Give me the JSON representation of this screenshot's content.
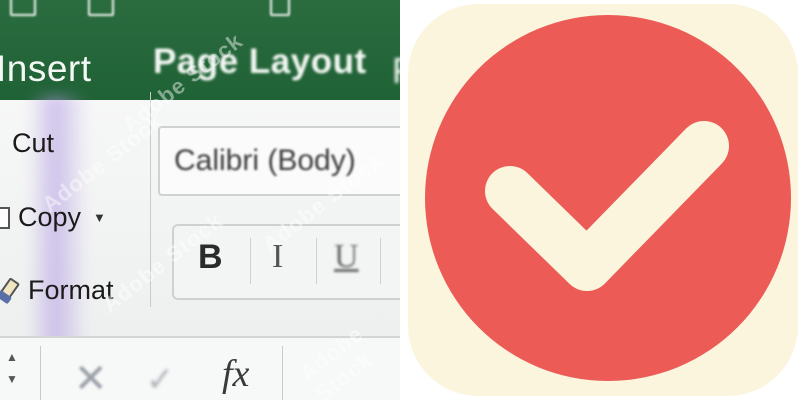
{
  "ribbon": {
    "tabs": [
      "Insert",
      "Page Layout"
    ],
    "clipboard": {
      "cut_label": "Cut",
      "copy_label": "Copy",
      "copy_arrow": "▼",
      "format_label": "Format"
    },
    "font_name": "Calibri (Body)",
    "format_buttons": {
      "bold": "B",
      "italic": "I",
      "underline": "U"
    }
  },
  "formula_bar": {
    "cancel_glyph": "✕",
    "enter_glyph": "✓",
    "fx_label": "fx"
  },
  "watermark": "Adobe Stock",
  "app_icon": {
    "name": "checkmark-icon",
    "colors": {
      "tile": "#fbf5de",
      "circle": "#ec5b55",
      "check": "#fbf5de"
    }
  }
}
